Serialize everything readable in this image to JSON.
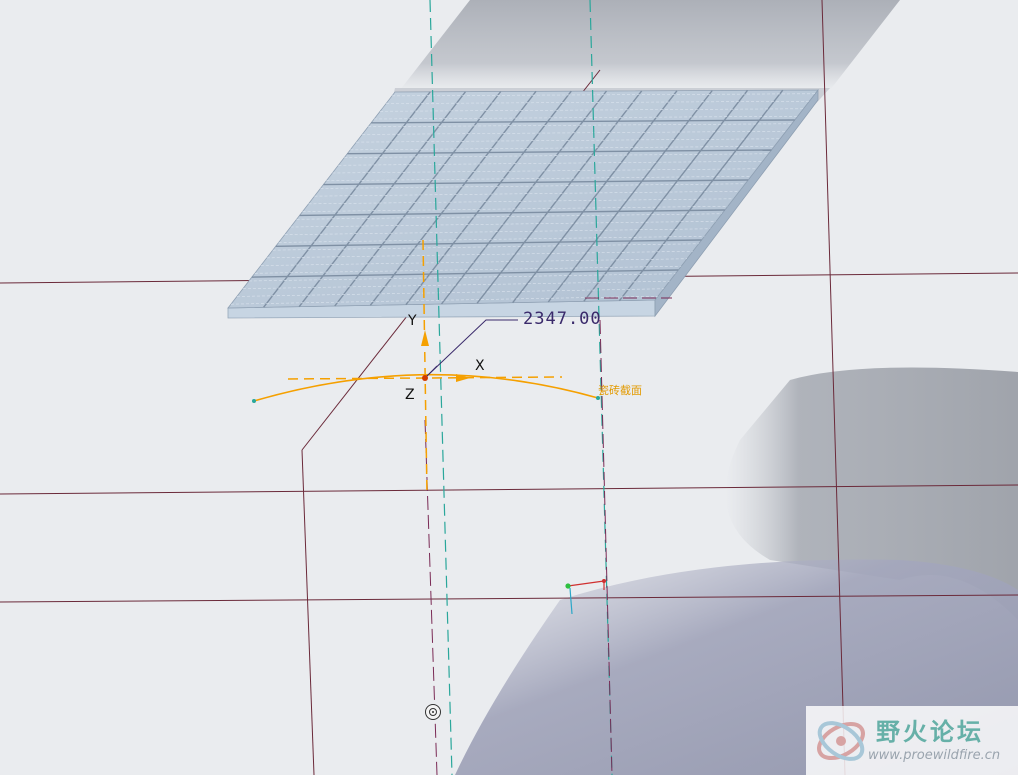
{
  "model_view": {
    "dimension": {
      "value": "2347.00"
    },
    "csys": {
      "x_label": "X",
      "y_label": "Y",
      "z_label": "Z"
    },
    "sketch": {
      "section_label": "瓷砖截面"
    },
    "panel": {
      "rows": 7,
      "cols": 12
    },
    "colors": {
      "background": "#eaecef",
      "datum_plane": "#6b2a3a",
      "datum_axis": "#2aa79b",
      "sketch": "#f5a000",
      "dimension": "#3a2a6b",
      "panel_fill": "#b9c9da",
      "shadow": "#9ea6b6"
    }
  },
  "watermark": {
    "title": "野火论坛",
    "url": "www.proewildfire.cn"
  }
}
